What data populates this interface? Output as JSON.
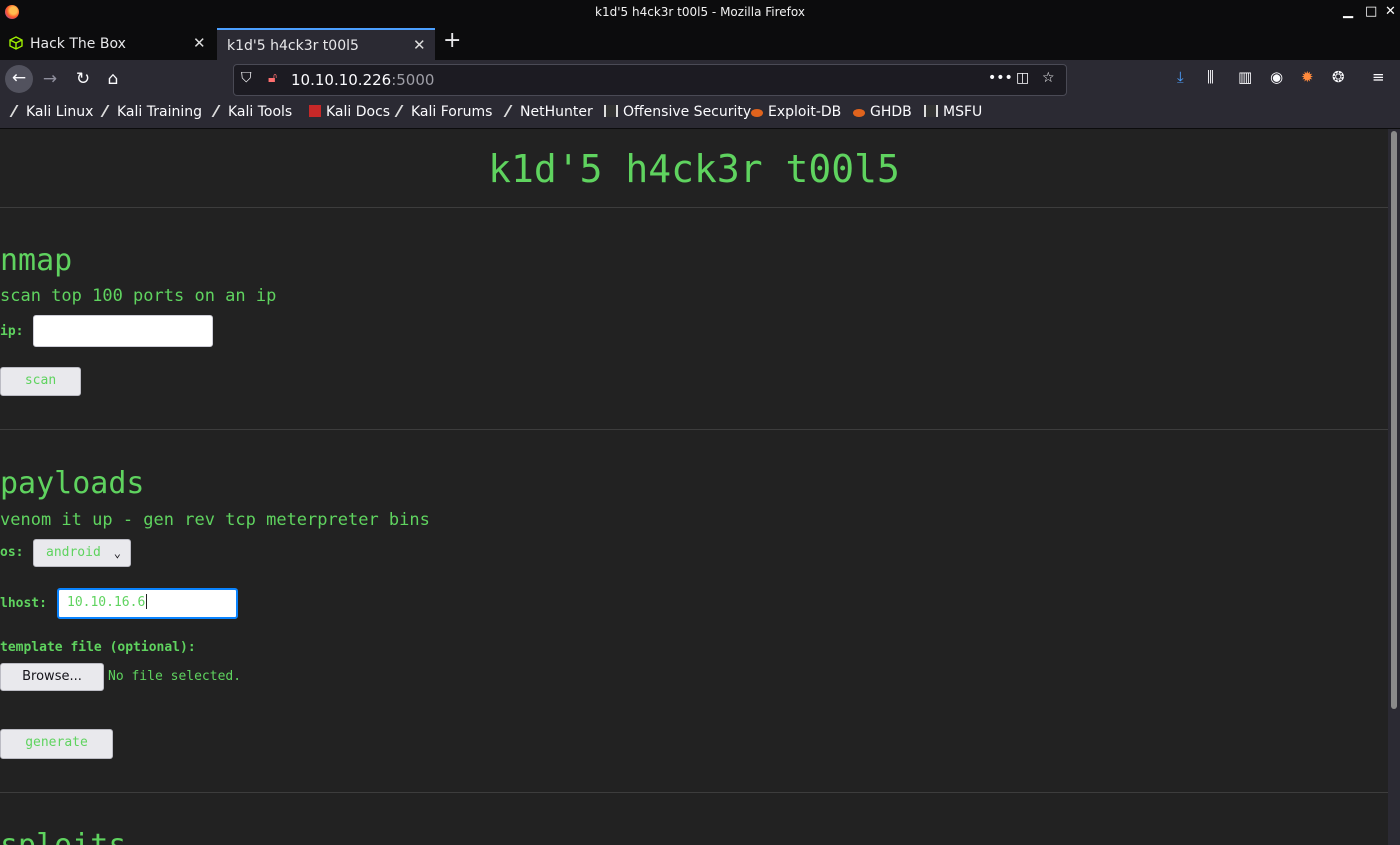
{
  "window": {
    "title": "k1d'5 h4ck3r t00l5 - Mozilla Firefox"
  },
  "tabs": [
    {
      "label": "Hack The Box",
      "active": false
    },
    {
      "label": "k1d'5 h4ck3r t00l5",
      "active": true
    }
  ],
  "urlbar": {
    "host": "10.10.10.226",
    "port": ":5000"
  },
  "bookmarks": [
    "Kali Linux",
    "Kali Training",
    "Kali Tools",
    "Kali Docs",
    "Kali Forums",
    "NetHunter",
    "Offensive Security",
    "Exploit-DB",
    "GHDB",
    "MSFU"
  ],
  "page": {
    "title": "k1d'5 h4ck3r t00l5",
    "nmap": {
      "heading": "nmap",
      "description": "scan top 100 ports on an ip",
      "ip_label": "ip:",
      "ip_value": "",
      "scan_button": "scan"
    },
    "payloads": {
      "heading": "payloads",
      "description": "venom it up - gen rev tcp meterpreter bins",
      "os_label": "os:",
      "os_selected": "android",
      "lhost_label": "lhost:",
      "lhost_value": "10.10.16.6",
      "template_label": "template file (optional):",
      "browse_button": "Browse...",
      "no_file_text": "No file selected.",
      "generate_button": "generate"
    },
    "exploits": {
      "heading": "sploits"
    }
  },
  "colors": {
    "accent_green": "#5fd35f",
    "page_bg": "#222222",
    "focus_blue": "#0a84ff"
  }
}
